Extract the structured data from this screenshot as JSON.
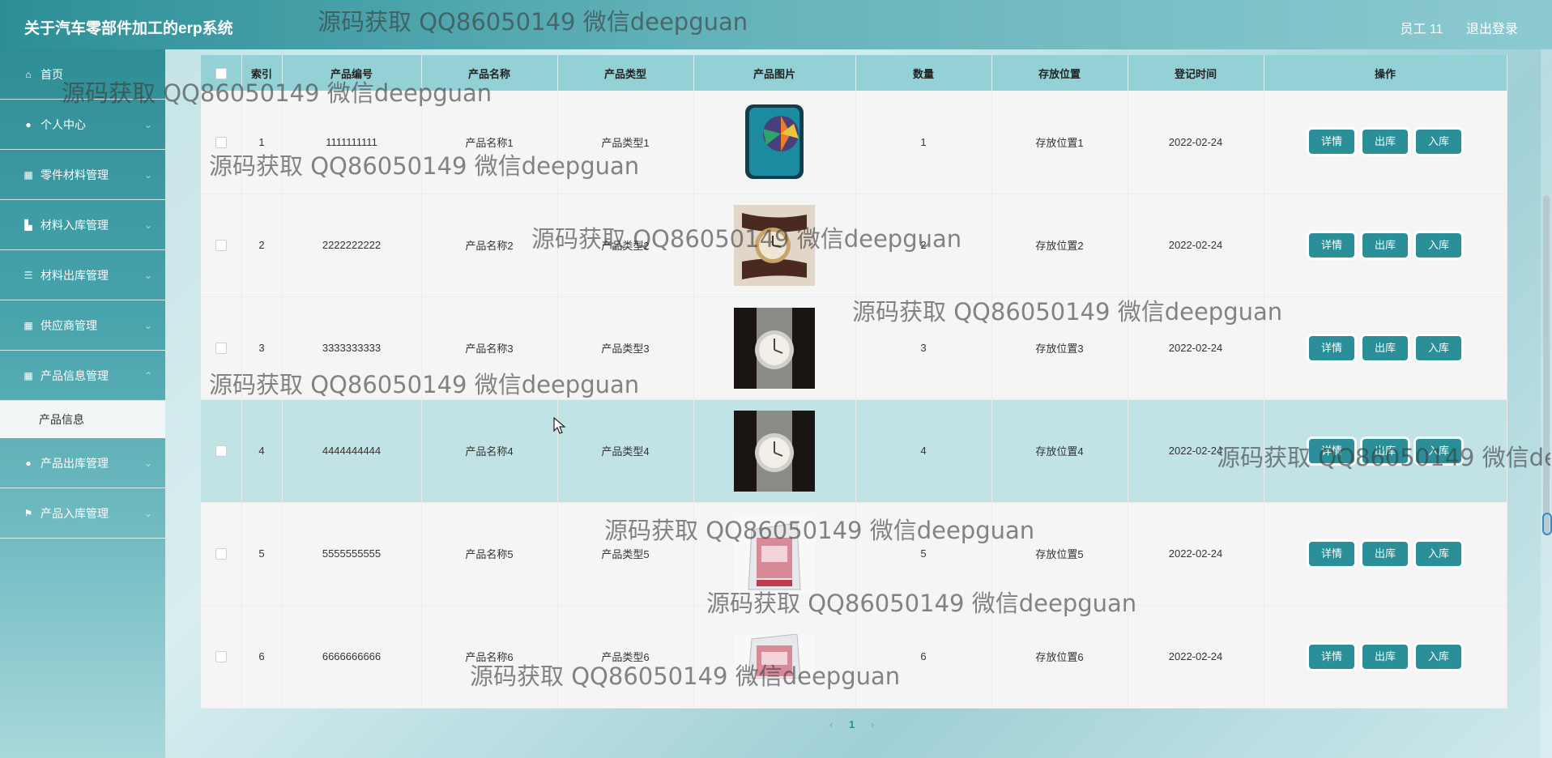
{
  "header": {
    "app_title": "关于汽车零部件加工的erp系统",
    "user_label": "员工 11",
    "logout_label": "退出登录"
  },
  "sidebar": {
    "items": [
      {
        "label": "首页",
        "icon": "home-icon",
        "has_children": false
      },
      {
        "label": "个人中心",
        "icon": "user-icon",
        "has_children": true
      },
      {
        "label": "零件材料管理",
        "icon": "grid-icon",
        "has_children": true
      },
      {
        "label": "材料入库管理",
        "icon": "stock-in-icon",
        "has_children": true
      },
      {
        "label": "材料出库管理",
        "icon": "list-icon",
        "has_children": true
      },
      {
        "label": "供应商管理",
        "icon": "grid-icon",
        "has_children": true
      },
      {
        "label": "产品信息管理",
        "icon": "grid-icon",
        "has_children": true
      }
    ],
    "active_submenu": "产品信息",
    "items_after": [
      {
        "label": "产品出库管理",
        "icon": "user-icon",
        "has_children": true
      },
      {
        "label": "产品入库管理",
        "icon": "flag-icon",
        "has_children": true
      }
    ]
  },
  "table": {
    "columns": [
      "索引",
      "产品编号",
      "产品名称",
      "产品类型",
      "产品图片",
      "数量",
      "存放位置",
      "登记时间",
      "操作"
    ],
    "rows": [
      {
        "index": "1",
        "code": "1111111111",
        "name": "产品名称1",
        "type": "产品类型1",
        "image": "phone-image",
        "qty": "1",
        "location": "存放位置1",
        "date": "2022-02-24"
      },
      {
        "index": "2",
        "code": "2222222222",
        "name": "产品名称2",
        "type": "产品类型2",
        "image": "watch-image",
        "qty": "2",
        "location": "存放位置2",
        "date": "2022-02-24"
      },
      {
        "index": "3",
        "code": "3333333333",
        "name": "产品名称3",
        "type": "产品类型3",
        "image": "watch-box-image",
        "qty": "3",
        "location": "存放位置3",
        "date": "2022-02-24"
      },
      {
        "index": "4",
        "code": "4444444444",
        "name": "产品名称4",
        "type": "产品类型4",
        "image": "watch-box-image",
        "qty": "4",
        "location": "存放位置4",
        "date": "2022-02-24"
      },
      {
        "index": "5",
        "code": "5555555555",
        "name": "产品名称5",
        "type": "产品类型5",
        "image": "package-image",
        "qty": "5",
        "location": "存放位置5",
        "date": "2022-02-24"
      },
      {
        "index": "6",
        "code": "6666666666",
        "name": "产品名称6",
        "type": "产品类型6",
        "image": "package-image",
        "qty": "6",
        "location": "存放位置6",
        "date": "2022-02-24"
      }
    ],
    "actions": {
      "detail": "详情",
      "out": "出库",
      "in": "入库"
    },
    "highlighted_row": 4
  },
  "pagination": {
    "prev": "‹",
    "current": "1",
    "next": "›"
  },
  "watermark": "源码获取 QQ86050149 微信deepguan",
  "colors": {
    "accent": "#2a8f98",
    "header_bg": "#94d1d7",
    "highlight_row": "#c2e3e6"
  }
}
